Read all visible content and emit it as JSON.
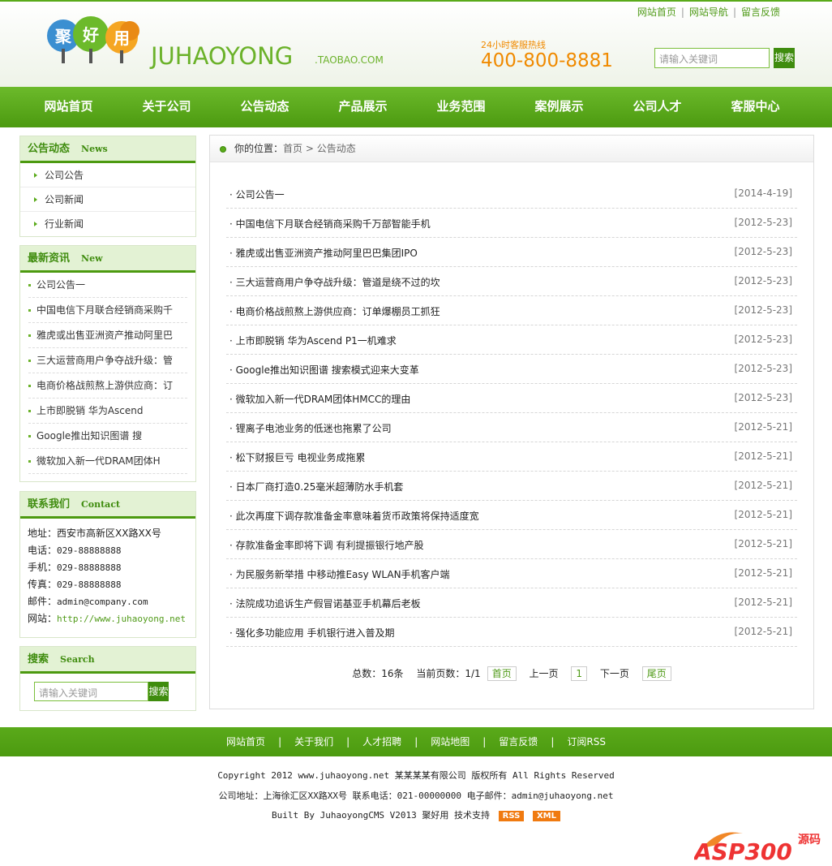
{
  "header": {
    "logo_text": "JUHAOYONG",
    "logo_suffix": ".TAOBAO.COM",
    "logo_chars": [
      "聚",
      "好",
      "用"
    ],
    "hotline_label": "24小时客服热线",
    "hotline_number": "400-800-8881",
    "top_links": [
      "网站首页",
      "网站导航",
      "留言反馈"
    ],
    "search_placeholder": "请输入关键词",
    "search_button": "搜索"
  },
  "nav": [
    "网站首页",
    "关于公司",
    "公告动态",
    "产品展示",
    "业务范围",
    "案例展示",
    "公司人才",
    "客服中心"
  ],
  "sidebar": {
    "categories": {
      "title": "公告动态",
      "title_en": "News",
      "items": [
        "公司公告",
        "公司新闻",
        "行业新闻"
      ]
    },
    "latest": {
      "title": "最新资讯",
      "title_en": "New",
      "items": [
        "公司公告一",
        "中国电信下月联合经销商采购千",
        "雅虎或出售亚洲资产推动阿里巴",
        "三大运营商用户争夺战升级：管",
        "电商价格战煎熬上游供应商：订",
        "上市即脱销 华为Ascend",
        "Google推出知识图谱 搜",
        "微软加入新一代DRAM团体H"
      ]
    },
    "contact": {
      "title": "联系我们",
      "title_en": "Contact",
      "lines": [
        {
          "label": "地址：",
          "value": "西安市高新区XX路XX号"
        },
        {
          "label": "电话：",
          "value": "029-88888888"
        },
        {
          "label": "手机：",
          "value": "029-88888888"
        },
        {
          "label": "传真：",
          "value": "029-88888888"
        },
        {
          "label": "邮件：",
          "value": "admin@company.com"
        },
        {
          "label": "网站：",
          "value": "http://www.juhaoyong.net"
        }
      ]
    },
    "search": {
      "title": "搜索",
      "title_en": "Search",
      "placeholder": "请输入关键词",
      "button": "搜索"
    }
  },
  "main": {
    "breadcrumb_prefix": "你的位置：",
    "breadcrumb_home": "首页",
    "breadcrumb_sep": ">",
    "breadcrumb_current": "公告动态",
    "articles": [
      {
        "title": "· 公司公告一",
        "date": "[2014-4-19]"
      },
      {
        "title": "· 中国电信下月联合经销商采购千万部智能手机",
        "date": "[2012-5-23]"
      },
      {
        "title": "· 雅虎或出售亚洲资产推动阿里巴巴集团IPO",
        "date": "[2012-5-23]"
      },
      {
        "title": "· 三大运营商用户争夺战升级：管道是绕不过的坎",
        "date": "[2012-5-23]"
      },
      {
        "title": "· 电商价格战煎熬上游供应商：订单爆棚员工抓狂",
        "date": "[2012-5-23]"
      },
      {
        "title": "· 上市即脱销 华为Ascend P1一机难求",
        "date": "[2012-5-23]"
      },
      {
        "title": "· Google推出知识图谱 搜索模式迎来大变革",
        "date": "[2012-5-23]"
      },
      {
        "title": "· 微软加入新一代DRAM团体HMCC的理由",
        "date": "[2012-5-23]"
      },
      {
        "title": "· 锂离子电池业务的低迷也拖累了公司",
        "date": "[2012-5-21]"
      },
      {
        "title": "· 松下财报巨亏 电视业务成拖累",
        "date": "[2012-5-21]"
      },
      {
        "title": "· 日本厂商打造0.25毫米超薄防水手机套",
        "date": "[2012-5-21]"
      },
      {
        "title": "· 此次再度下调存款准备金率意味着货币政策将保持适度宽",
        "date": "[2012-5-21]"
      },
      {
        "title": "· 存款准备金率即将下调 有利提振银行地产股",
        "date": "[2012-5-21]"
      },
      {
        "title": "· 为民服务新举措 中移动推Easy WLAN手机客户端",
        "date": "[2012-5-21]"
      },
      {
        "title": "· 法院成功追诉生产假冒诺基亚手机幕后老板",
        "date": "[2012-5-21]"
      },
      {
        "title": "· 强化多功能应用 手机银行进入普及期",
        "date": "[2012-5-21]"
      }
    ],
    "pager": {
      "total": "总数：16条",
      "current": "当前页数：1/1",
      "first": "首页",
      "prev": "上一页",
      "page": "1",
      "next": "下一页",
      "last": "尾页"
    }
  },
  "footer": {
    "links": [
      "网站首页",
      "关于我们",
      "人才招聘",
      "网站地图",
      "留言反馈",
      "订阅RSS"
    ],
    "copyright": "Copyright 2012 www.juhaoyong.net 某某某某有限公司 版权所有 All Rights Reserved",
    "address": "公司地址：上海徐汇区XX路XX号 联系电话：021-00000000 电子邮件：admin@juhaoyong.net",
    "built_by": "Built By JuhaoyongCMS V2013 聚好用 技术支持",
    "badges": [
      "RSS",
      "XML"
    ]
  },
  "watermark": {
    "text": "ASP300",
    "sub": "源码"
  },
  "colors": {
    "brand_green": "#4c9a10",
    "accent_orange": "#f08a00"
  }
}
